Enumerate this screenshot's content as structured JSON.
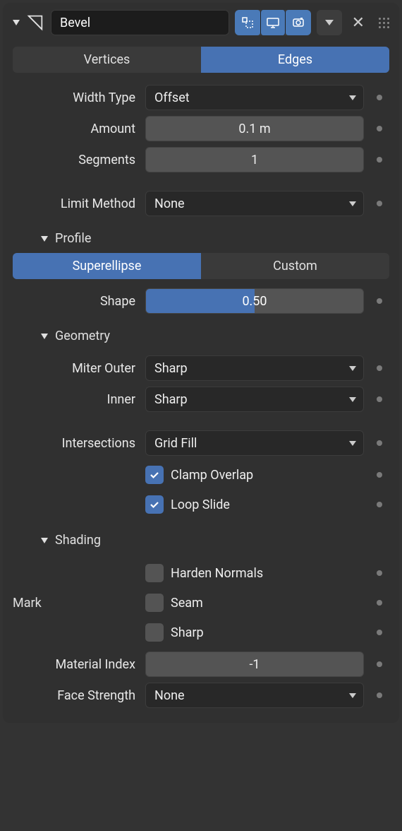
{
  "header": {
    "name": "Bevel"
  },
  "tabs": {
    "a": "Vertices",
    "b": "Edges"
  },
  "width_type": {
    "label": "Width Type",
    "value": "Offset"
  },
  "amount": {
    "label": "Amount",
    "value": "0.1 m"
  },
  "segments": {
    "label": "Segments",
    "value": "1"
  },
  "limit_method": {
    "label": "Limit Method",
    "value": "None"
  },
  "sections": {
    "profile": "Profile",
    "geometry": "Geometry",
    "shading": "Shading"
  },
  "profile_tabs": {
    "a": "Superellipse",
    "b": "Custom"
  },
  "shape": {
    "label": "Shape",
    "value": "0.50"
  },
  "miter_outer": {
    "label": "Miter Outer",
    "value": "Sharp"
  },
  "inner": {
    "label": "Inner",
    "value": "Sharp"
  },
  "intersections": {
    "label": "Intersections",
    "value": "Grid Fill"
  },
  "clamp": {
    "label": "Clamp Overlap"
  },
  "loop": {
    "label": "Loop Slide"
  },
  "harden": {
    "label": "Harden Normals"
  },
  "mark": {
    "label": "Mark"
  },
  "seam": {
    "label": "Seam"
  },
  "sharp": {
    "label": "Sharp"
  },
  "material": {
    "label": "Material Index",
    "value": "-1"
  },
  "face_strength": {
    "label": "Face Strength",
    "value": "None"
  }
}
